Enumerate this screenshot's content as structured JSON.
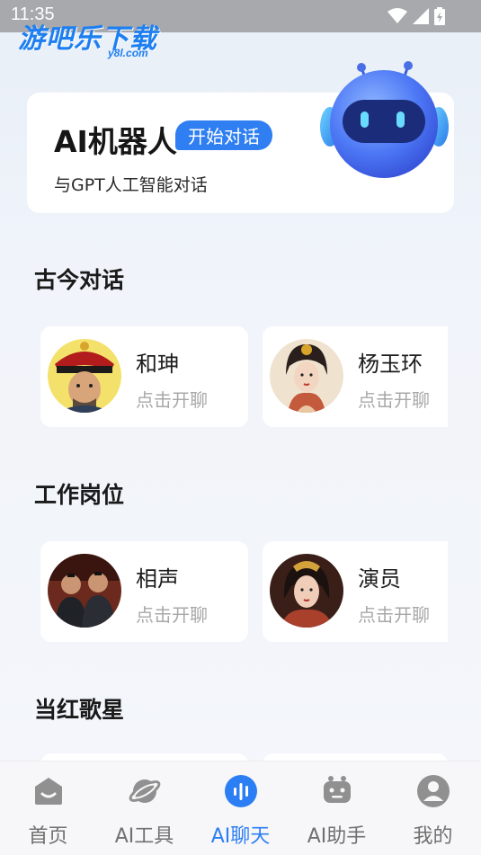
{
  "status_bar": {
    "time": "11:35"
  },
  "watermark": {
    "main": "游吧乐下载",
    "sub": "y8l.com"
  },
  "hero": {
    "title": "AI机器人",
    "badge": "开始对话",
    "subtitle": "与GPT人工智能对话"
  },
  "sections": [
    {
      "title": "古今对话",
      "cards": [
        {
          "name": "和珅",
          "action": "点击开聊"
        },
        {
          "name": "杨玉环",
          "action": "点击开聊"
        }
      ]
    },
    {
      "title": "工作岗位",
      "cards": [
        {
          "name": "相声",
          "action": "点击开聊"
        },
        {
          "name": "演员",
          "action": "点击开聊"
        }
      ]
    },
    {
      "title": "当红歌星"
    }
  ],
  "tabs": [
    {
      "label": "首页",
      "icon": "home-icon"
    },
    {
      "label": "AI工具",
      "icon": "planet-icon"
    },
    {
      "label": "AI聊天",
      "icon": "voice-icon",
      "active": true
    },
    {
      "label": "AI助手",
      "icon": "robot-icon"
    },
    {
      "label": "我的",
      "icon": "user-icon"
    }
  ],
  "colors": {
    "accent": "#2c7ef4",
    "inactive": "#707070"
  }
}
